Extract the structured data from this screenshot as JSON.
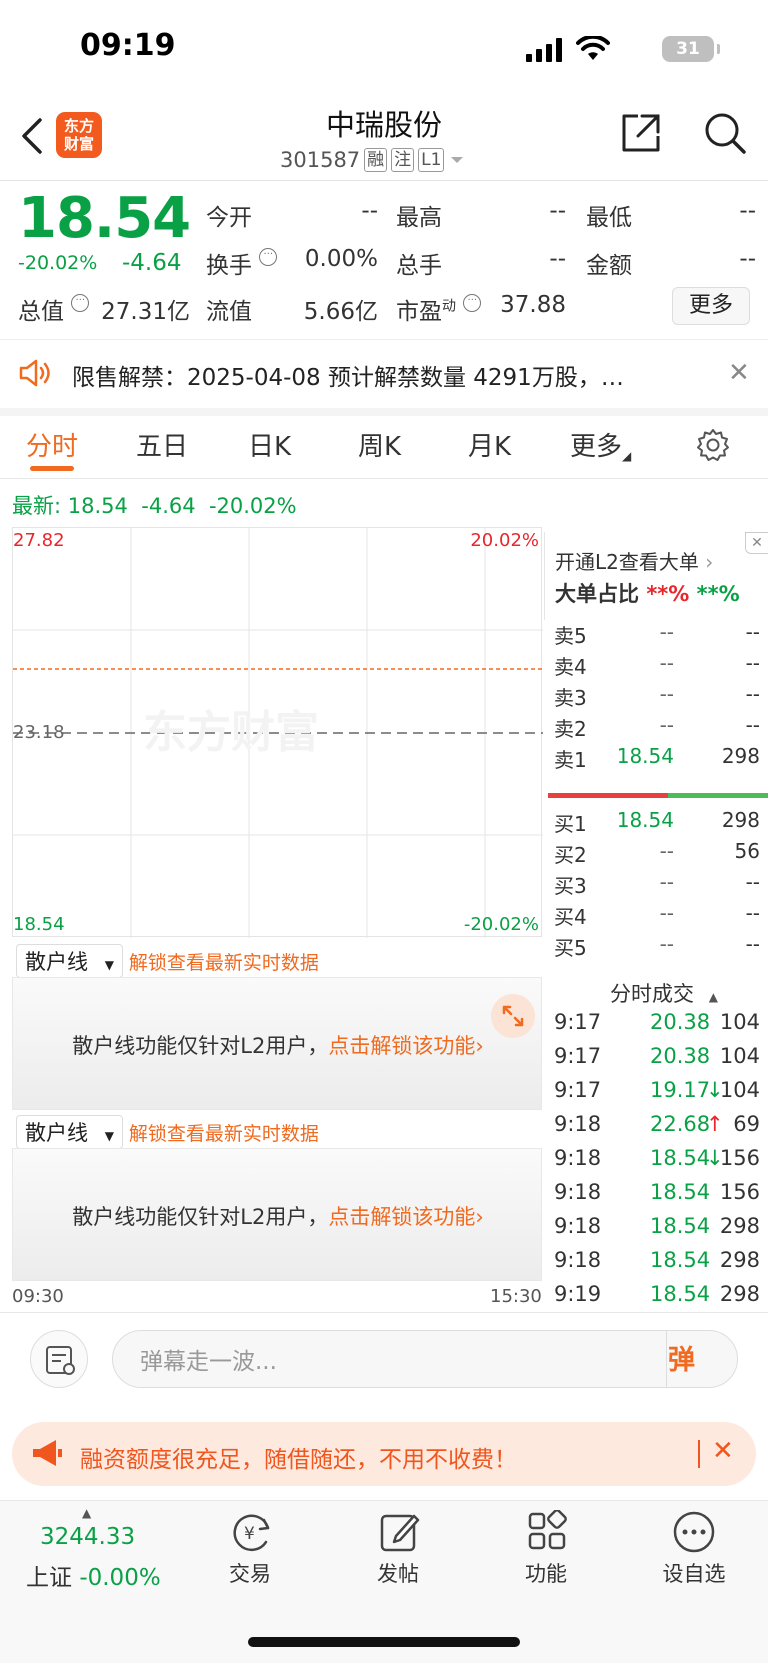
{
  "status_bar": {
    "time": "09:19",
    "battery": "31"
  },
  "header": {
    "logo_line1": "东方",
    "logo_line2": "财富",
    "name": "中瑞股份",
    "code": "301587",
    "tags": [
      "融",
      "注",
      "L1"
    ]
  },
  "quote": {
    "price": "18.54",
    "pct": "-20.02%",
    "change": "-4.64",
    "fields": [
      {
        "label": "今开",
        "value": "--"
      },
      {
        "label": "最高",
        "value": "--"
      },
      {
        "label": "最低",
        "value": "--"
      },
      {
        "label": "换手",
        "value": "0.00%"
      },
      {
        "label": "总手",
        "value": "--"
      },
      {
        "label": "金额",
        "value": "--"
      },
      {
        "label": "总值",
        "value": "27.31亿"
      },
      {
        "label": "流值",
        "value": "5.66亿"
      },
      {
        "label": "市盈",
        "superscript": "动",
        "value": "37.88"
      }
    ],
    "more_label": "更多"
  },
  "notice": {
    "text": "限售解禁：2025-04-08 预计解禁数量 4291万股，…"
  },
  "tabs": [
    "分时",
    "五日",
    "日K",
    "周K",
    "月K",
    "更多"
  ],
  "latest": {
    "label": "最新:",
    "price": "18.54",
    "change": "-4.64",
    "pct": "-20.02%"
  },
  "chart": {
    "top_price": "27.82",
    "top_pct": "20.02%",
    "mid_price": "23.18",
    "bottom_price": "18.54",
    "bottom_pct": "-20.02%",
    "watermark": "东方财富",
    "time_start": "09:30",
    "time_end": "15:30"
  },
  "retail_panels": [
    {
      "select": "散户线",
      "unlock_link": "解锁查看最新实时数据",
      "msg": "散户线功能仅针对L2用户，",
      "msg_link": "点击解锁该功能"
    },
    {
      "select": "散户线",
      "unlock_link": "解锁查看最新实时数据",
      "msg": "散户线功能仅针对L2用户，",
      "msg_link": "点击解锁该功能"
    }
  ],
  "order_book": {
    "l2_link": "开通L2查看大单",
    "big_order_label": "大单占比",
    "big_order_red": "**%",
    "big_order_green": "**%",
    "sell": [
      {
        "label": "卖5",
        "price": "--",
        "vol": "--"
      },
      {
        "label": "卖4",
        "price": "--",
        "vol": "--"
      },
      {
        "label": "卖3",
        "price": "--",
        "vol": "--"
      },
      {
        "label": "卖2",
        "price": "--",
        "vol": "--"
      },
      {
        "label": "卖1",
        "price": "18.54",
        "vol": "298"
      }
    ],
    "buy": [
      {
        "label": "买1",
        "price": "18.54",
        "vol": "298"
      },
      {
        "label": "买2",
        "price": "--",
        "vol": "56"
      },
      {
        "label": "买3",
        "price": "--",
        "vol": "--"
      },
      {
        "label": "买4",
        "price": "--",
        "vol": "--"
      },
      {
        "label": "买5",
        "price": "--",
        "vol": "--"
      }
    ],
    "trades_title": "分时成交",
    "trades": [
      {
        "time": "9:17",
        "price": "20.38",
        "arrow": "",
        "vol": "104",
        "color": "green"
      },
      {
        "time": "9:17",
        "price": "20.38",
        "arrow": "",
        "vol": "104",
        "color": "green"
      },
      {
        "time": "9:17",
        "price": "19.17",
        "arrow": "↓",
        "vol": "104",
        "color": "green"
      },
      {
        "time": "9:18",
        "price": "22.68",
        "arrow": "↑",
        "vol": "69",
        "color": "green"
      },
      {
        "time": "9:18",
        "price": "18.54",
        "arrow": "↓",
        "vol": "156",
        "color": "green"
      },
      {
        "time": "9:18",
        "price": "18.54",
        "arrow": "",
        "vol": "156",
        "color": "green"
      },
      {
        "time": "9:18",
        "price": "18.54",
        "arrow": "",
        "vol": "298",
        "color": "green"
      },
      {
        "time": "9:18",
        "price": "18.54",
        "arrow": "",
        "vol": "298",
        "color": "green"
      },
      {
        "time": "9:19",
        "price": "18.54",
        "arrow": "",
        "vol": "298",
        "color": "green"
      }
    ]
  },
  "comment": {
    "placeholder": "弹幕走一波...",
    "danmu": "弹"
  },
  "promo": {
    "text": "融资额度很充足，随借随还，不用不收费！"
  },
  "bottom_nav": {
    "index_value": "3244.33",
    "index_name": "上证",
    "index_pct": "-0.00%",
    "items": [
      "交易",
      "发帖",
      "功能",
      "设自选"
    ]
  },
  "colors": {
    "up": "#e8262c",
    "down": "#0aa146",
    "accent": "#f06a1f"
  }
}
